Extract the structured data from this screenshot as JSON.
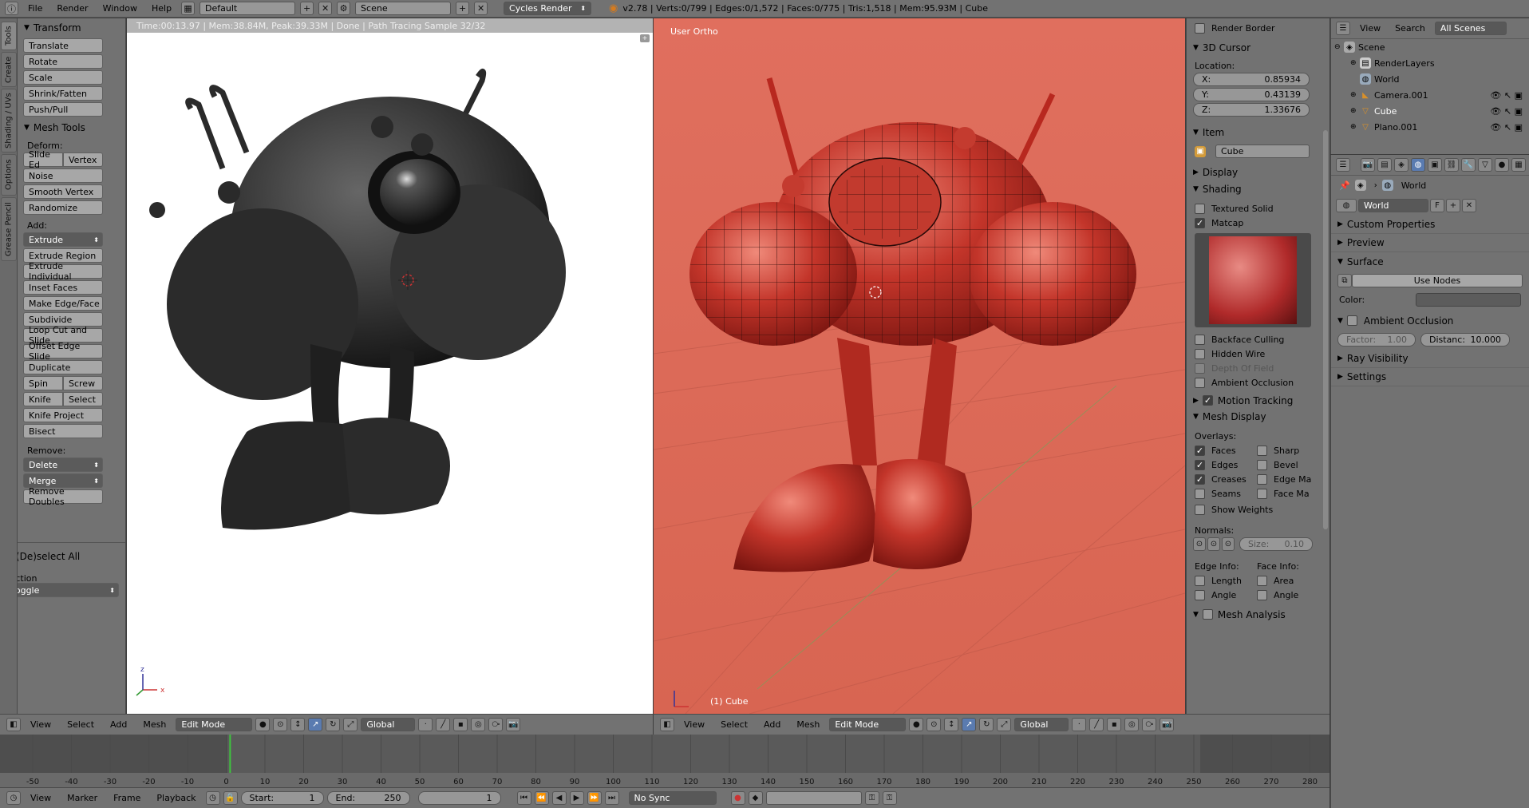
{
  "topbar": {
    "menus": [
      "File",
      "Render",
      "Window",
      "Help"
    ],
    "screen_layout": "Default",
    "scene": "Scene",
    "engine": "Cycles Render",
    "stats": "v2.78 | Verts:0/799 | Edges:0/1,572 | Faces:0/775 | Tris:1,518 | Mem:95.93M | Cube"
  },
  "left_tabs": [
    "Tools",
    "Create",
    "Shading / UVs",
    "Options",
    "Grease Pencil"
  ],
  "toolshelf": {
    "transform_title": "Transform",
    "transform": [
      "Translate",
      "Rotate",
      "Scale",
      "Shrink/Fatten",
      "Push/Pull"
    ],
    "mesh_tools_title": "Mesh Tools",
    "deform_label": "Deform:",
    "slide_edge": "Slide Ed",
    "vertex": "Vertex",
    "noise": "Noise",
    "smooth_vertex": "Smooth Vertex",
    "randomize": "Randomize",
    "add_label": "Add:",
    "extrude": "Extrude",
    "add_tools": [
      "Extrude Region",
      "Extrude Individual",
      "Inset Faces",
      "Make Edge/Face",
      "Subdivide",
      "Loop Cut and Slide",
      "Offset Edge Slide",
      "Duplicate"
    ],
    "spin": "Spin",
    "screw": "Screw",
    "knife": "Knife",
    "select": "Select",
    "knife_project": "Knife Project",
    "bisect": "Bisect",
    "remove_label": "Remove:",
    "delete": "Delete",
    "merge": "Merge",
    "remove_doubles": "Remove Doubles",
    "deselect_title": "(De)select All",
    "action_label": "Action",
    "action_value": "Toggle"
  },
  "render_view": {
    "status": "Time:00:13.97 | Mem:38.84M, Peak:39.33M | Done | Path Tracing Sample 32/32"
  },
  "view3d": {
    "label": "User Ortho",
    "object_label": "(1) Cube"
  },
  "npanel": {
    "render_border": "Render Border",
    "cursor_title": "3D Cursor",
    "location_label": "Location:",
    "x_label": "X:",
    "x_value": "0.85934",
    "y_label": "Y:",
    "y_value": "0.43139",
    "z_label": "Z:",
    "z_value": "1.33676",
    "item_title": "Item",
    "item_name": "Cube",
    "display_title": "Display",
    "shading_title": "Shading",
    "textured_solid": "Textured Solid",
    "matcap": "Matcap",
    "backface_culling": "Backface Culling",
    "hidden_wire": "Hidden Wire",
    "depth_of_field": "Depth Of Field",
    "ambient_occlusion": "Ambient Occlusion",
    "motion_tracking": "Motion Tracking",
    "mesh_display_title": "Mesh Display",
    "overlays_label": "Overlays:",
    "faces": "Faces",
    "sharp": "Sharp",
    "edges": "Edges",
    "bevel": "Bevel",
    "creases": "Creases",
    "edge_ma": "Edge Ma",
    "seams": "Seams",
    "face_ma": "Face Ma",
    "show_weights": "Show Weights",
    "normals_label": "Normals:",
    "size_label": "Size:",
    "size_value": "0.10",
    "edge_info_label": "Edge Info:",
    "face_info_label": "Face Info:",
    "length": "Length",
    "area": "Area",
    "angle_edge": "Angle",
    "angle_face": "Angle",
    "mesh_analysis": "Mesh Analysis"
  },
  "outliner": {
    "menus": [
      "View",
      "Search"
    ],
    "filter": "All Scenes",
    "items": [
      "Scene",
      "RenderLayers",
      "World",
      "Camera.001",
      "Cube",
      "Plano.001"
    ]
  },
  "properties": {
    "breadcrumb": "World",
    "world_name": "World",
    "fake_user": "F",
    "panels": [
      "Custom Properties",
      "Preview",
      "Surface"
    ],
    "use_nodes": "Use Nodes",
    "color_label": "Color:",
    "ambient_occlusion": "Ambient Occlusion",
    "factor_label": "Factor:",
    "factor_value": "1.00",
    "distance_label": "Distanc:",
    "distance_value": "10.000",
    "ray_visibility": "Ray Visibility",
    "settings": "Settings"
  },
  "view_header_left": {
    "menus": [
      "View",
      "Select",
      "Add",
      "Mesh"
    ],
    "mode": "Edit Mode",
    "orientation": "Global"
  },
  "view_header_right": {
    "menus": [
      "View",
      "Select",
      "Add",
      "Mesh"
    ],
    "mode": "Edit Mode",
    "orientation": "Global"
  },
  "timeline": {
    "ticks": [
      "-50",
      "-40",
      "-30",
      "-20",
      "-10",
      "0",
      "10",
      "20",
      "30",
      "40",
      "50",
      "60",
      "70",
      "80",
      "90",
      "100",
      "110",
      "120",
      "130",
      "140",
      "150",
      "160",
      "170",
      "180",
      "190",
      "200",
      "210",
      "220",
      "230",
      "240",
      "250",
      "260",
      "270",
      "280"
    ],
    "current_frame": 1,
    "menus": [
      "View",
      "Marker",
      "Frame",
      "Playback"
    ],
    "start_label": "Start:",
    "start_value": "1",
    "end_label": "End:",
    "end_value": "250",
    "frame_value": "1",
    "sync": "No Sync"
  },
  "colors": {
    "panel": "#727272",
    "viewport": "#d96754",
    "mesh": "#b8281f"
  }
}
